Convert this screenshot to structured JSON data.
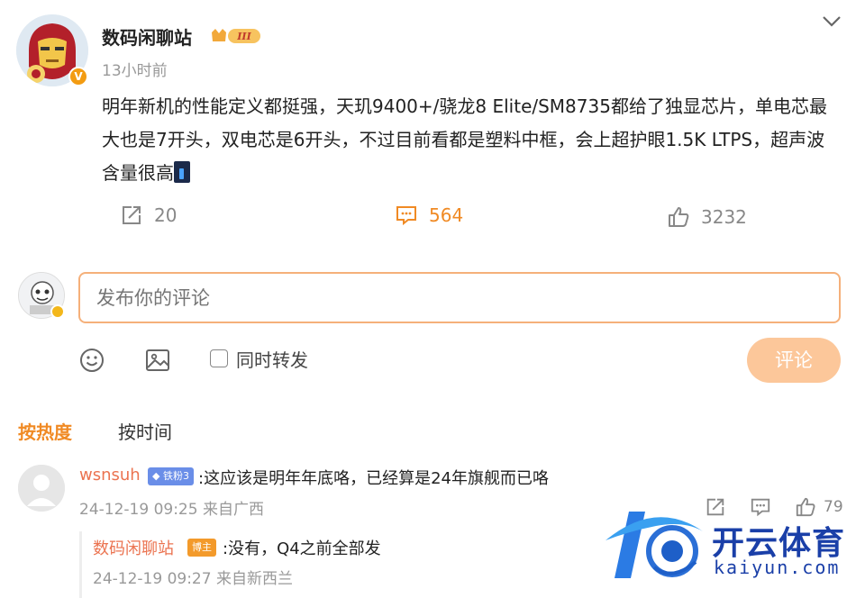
{
  "post": {
    "username": "数码闲聊站",
    "rank_badge": "III",
    "timestamp": "13小时前",
    "text": "明年新机的性能定义都挺强，天玑9400+/骁龙8 Elite/SM8735都给了独显芯片，单电芯最大也是7开头，双电芯是6开头，不过目前看都是塑料中框，会上超护眼1.5K LTPS，超声波含量很高",
    "reposts": "20",
    "comments": "564",
    "likes": "3232"
  },
  "composer": {
    "placeholder": "发布你的评论",
    "repost_label": "同时转发",
    "submit_label": "评论"
  },
  "sort_tabs": {
    "hot": "按热度",
    "time": "按时间"
  },
  "comments": [
    {
      "user": "wsnsuh",
      "badge": "铁粉3",
      "text": ":这应该是明年年底咯，已经算是24年旗舰而已咯",
      "meta": "24-12-19 09:25 来自广西",
      "likes": "79"
    }
  ],
  "replies": [
    {
      "user": "数码闲聊站",
      "badge": "博主",
      "text": ":没有，Q4之前全部发",
      "meta": "24-12-19 09:27 来自新西兰"
    }
  ],
  "watermark": {
    "cn": "开云体育",
    "en": "kaiyun.com"
  },
  "colors": {
    "accent": "#f08a24",
    "username": "#eb7350",
    "button_disabled": "#fcc79a",
    "input_border": "#f5b07a",
    "watermark": "#1a3fa8"
  }
}
